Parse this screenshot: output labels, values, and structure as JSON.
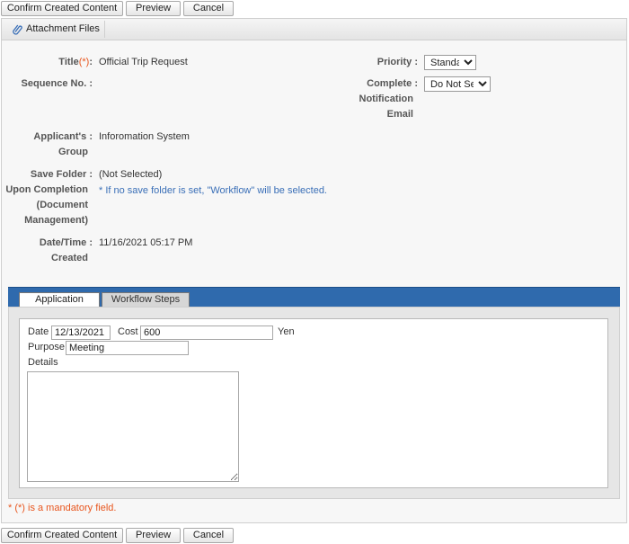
{
  "toolbar": {
    "confirm_label": "Confirm Created Content",
    "preview_label": "Preview",
    "cancel_label": "Cancel"
  },
  "attachment_tab": {
    "label": "Attachment Files",
    "icon": "paperclip-icon"
  },
  "form": {
    "title_label": "Title",
    "required_marker": "(*)",
    "colon": ":",
    "title_value": "Official Trip Request",
    "sequence_label": "Sequence No.",
    "sequence_value": "",
    "priority_label": "Priority",
    "priority_value": "Standard",
    "notify_label_1": "Complete",
    "notify_label_2": "Notification",
    "notify_label_3": "Email",
    "notify_value": "Do Not Send",
    "group_label_1": "Applicant's",
    "group_label_2": "Group",
    "group_value": "Inforomation System",
    "folder_label_1": "Save Folder",
    "folder_label_2": "Upon Completion",
    "folder_label_3": "(Document",
    "folder_label_4": "Management)",
    "folder_value": "(Not Selected)",
    "folder_hint": "* If no save folder is set, \"Workflow\" will be selected.",
    "created_label_1": "Date/Time",
    "created_label_2": "Created",
    "created_value": "11/16/2021 05:17 PM"
  },
  "tabs": [
    {
      "label": "Application",
      "active": true
    },
    {
      "label": "Workflow Steps",
      "active": false
    }
  ],
  "application": {
    "date_label": "Date",
    "date_value": "12/13/2021",
    "cost_label": "Cost",
    "cost_value": "600",
    "currency": "Yen",
    "purpose_label": "Purpose",
    "purpose_value": "Meeting",
    "details_label": "Details",
    "details_value": ""
  },
  "footer": {
    "mandatory_note": "* (*) is a mandatory field."
  },
  "colors": {
    "accent_blue": "#2f6aad",
    "required_orange": "#e8561e",
    "hint_blue": "#3a6fb7"
  }
}
